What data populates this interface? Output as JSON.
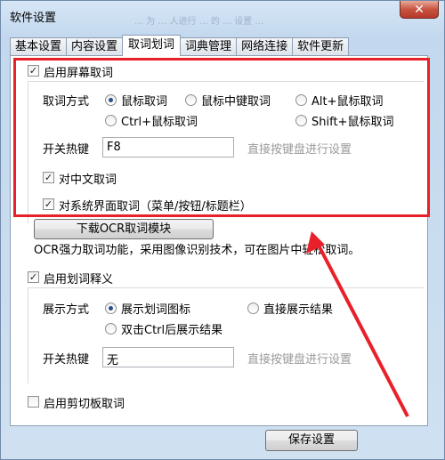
{
  "window": {
    "title": "软件设置",
    "faded_subtitle": "… 为 … 人进行 … 的 … 设置 …"
  },
  "tabs": [
    "基本设置",
    "内容设置",
    "取词划词",
    "词典管理",
    "网络连接",
    "软件更新"
  ],
  "screen_capture": {
    "enable_label": "启用屏幕取词",
    "enabled": true,
    "mode_label": "取词方式",
    "modes": [
      "鼠标取词",
      "鼠标中键取词",
      "Alt+鼠标取词",
      "Ctrl+鼠标取词",
      "Shift+鼠标取词"
    ],
    "selected_mode": "鼠标取词",
    "hotkey_label": "开关热键",
    "hotkey_value": "F8",
    "hotkey_hint": "直接按键盘进行设置",
    "chinese_label": "对中文取词",
    "chinese_checked": true,
    "system_label": "对系统界面取词（菜单/按钮/标题栏）",
    "system_checked": true,
    "ocr_button": "下载OCR取词模块",
    "ocr_desc": "OCR强力取词功能，采用图像识别技术，可在图片中轻松取词。"
  },
  "selection": {
    "enable_label": "启用划词释义",
    "enabled": true,
    "display_label": "展示方式",
    "options": [
      "展示划词图标",
      "直接展示结果",
      "双击Ctrl后展示结果"
    ],
    "selected_option": "展示划词图标",
    "hotkey_label": "开关热键",
    "hotkey_value": "无",
    "hotkey_hint": "直接按键盘进行设置"
  },
  "clipboard": {
    "enable_label": "启用剪切板取词",
    "enabled": false
  },
  "footer": {
    "save_button": "保存设置"
  },
  "colors": {
    "highlight": "#e8202a",
    "panel": "#ffffff",
    "frame": "#c9dcef"
  }
}
